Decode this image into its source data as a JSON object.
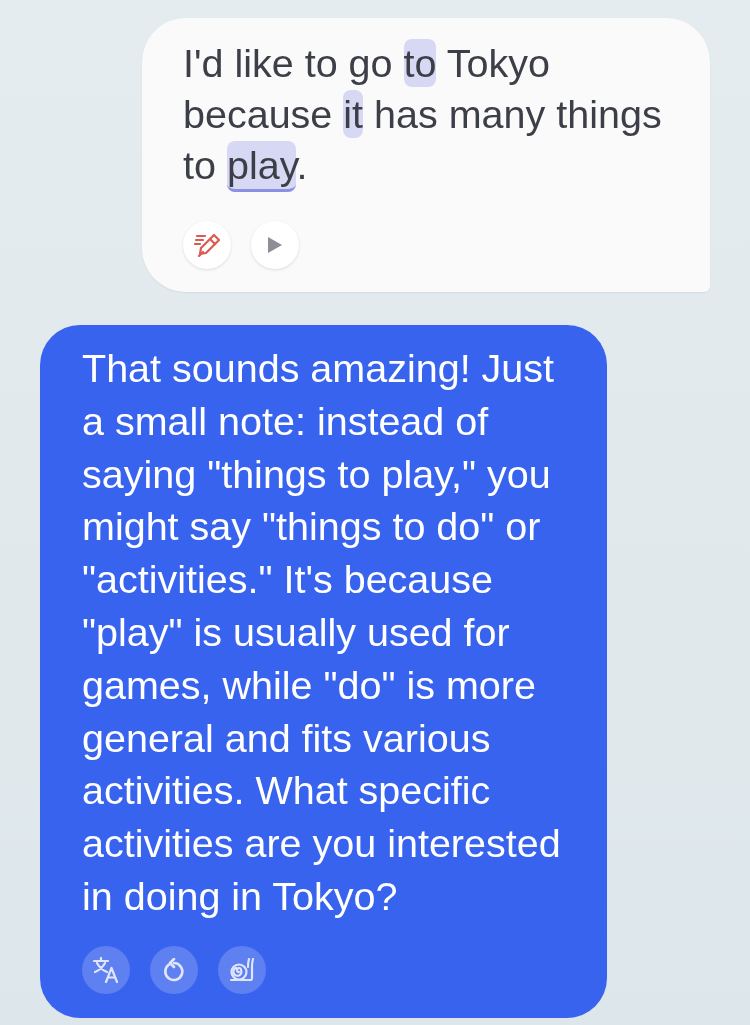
{
  "messages": [
    {
      "kind": "user",
      "segments": [
        {
          "text": "I'd like to go ",
          "highlighted": false,
          "underlined": false
        },
        {
          "text": "to",
          "highlighted": true,
          "underlined": false
        },
        {
          "text": " Tokyo because ",
          "highlighted": false,
          "underlined": false
        },
        {
          "text": "it",
          "highlighted": true,
          "underlined": false
        },
        {
          "text": " has many things to ",
          "highlighted": false,
          "underlined": false
        },
        {
          "text": "play",
          "highlighted": true,
          "underlined": true
        },
        {
          "text": ".",
          "highlighted": false,
          "underlined": false
        }
      ],
      "actions": [
        {
          "kind": "correct"
        },
        {
          "kind": "play"
        }
      ]
    },
    {
      "kind": "assistant",
      "segments": [
        {
          "text": "That sounds amazing! Just a small note: instead of saying \"things to play,\" you might say \"things to do\" or \"activities.\" It's because \"play\" is usually used for games, while \"do\" is more general and fits various activities. What specific activities are you interested in doing in Tokyo?",
          "highlighted": false,
          "underlined": false
        }
      ],
      "actions": [
        {
          "kind": "translate"
        },
        {
          "kind": "replay"
        },
        {
          "kind": "slow"
        }
      ]
    }
  ]
}
